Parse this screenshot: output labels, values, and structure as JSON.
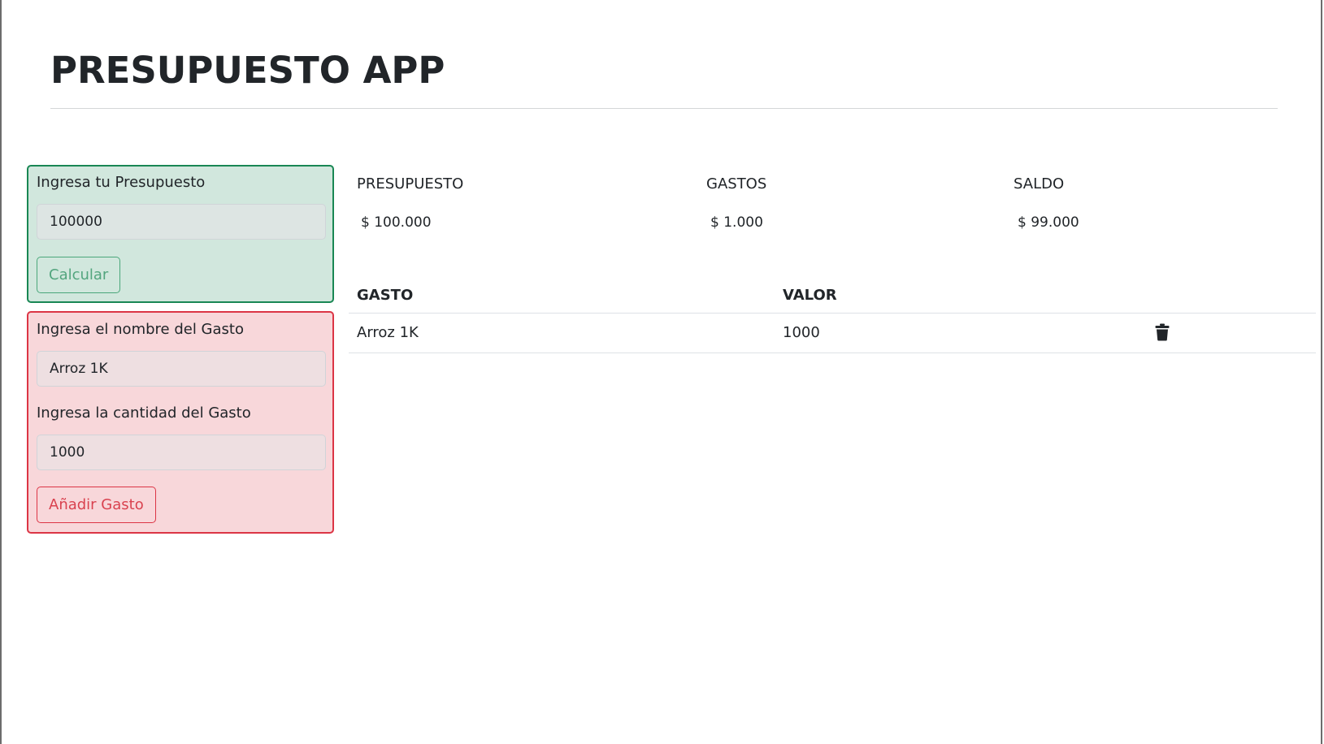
{
  "app": {
    "title": "PRESUPUESTO APP"
  },
  "budget_form": {
    "label": "Ingresa tu Presupuesto",
    "input_value": "100000",
    "button_label": "Calcular",
    "colors": {
      "background": "#d1e7dd",
      "border": "#198754"
    }
  },
  "expense_form": {
    "name_label": "Ingresa el nombre del Gasto",
    "name_value": "Arroz 1K",
    "amount_label": "Ingresa la cantidad del Gasto",
    "amount_value": "1000",
    "button_label": "Añadir Gasto",
    "colors": {
      "background": "#f8d7da",
      "border": "#dc3545"
    }
  },
  "summary": {
    "budget_label": "PRESUPUESTO",
    "budget_value": "$ 100.000",
    "expenses_label": "GASTOS",
    "expenses_value": "$ 1.000",
    "balance_label": "SALDO",
    "balance_value": "$ 99.000"
  },
  "expenses_table": {
    "columns": [
      "GASTO",
      "VALOR"
    ],
    "rows": [
      {
        "name": "Arroz 1K",
        "value": "1000",
        "action_icon": "trash-icon"
      }
    ]
  }
}
